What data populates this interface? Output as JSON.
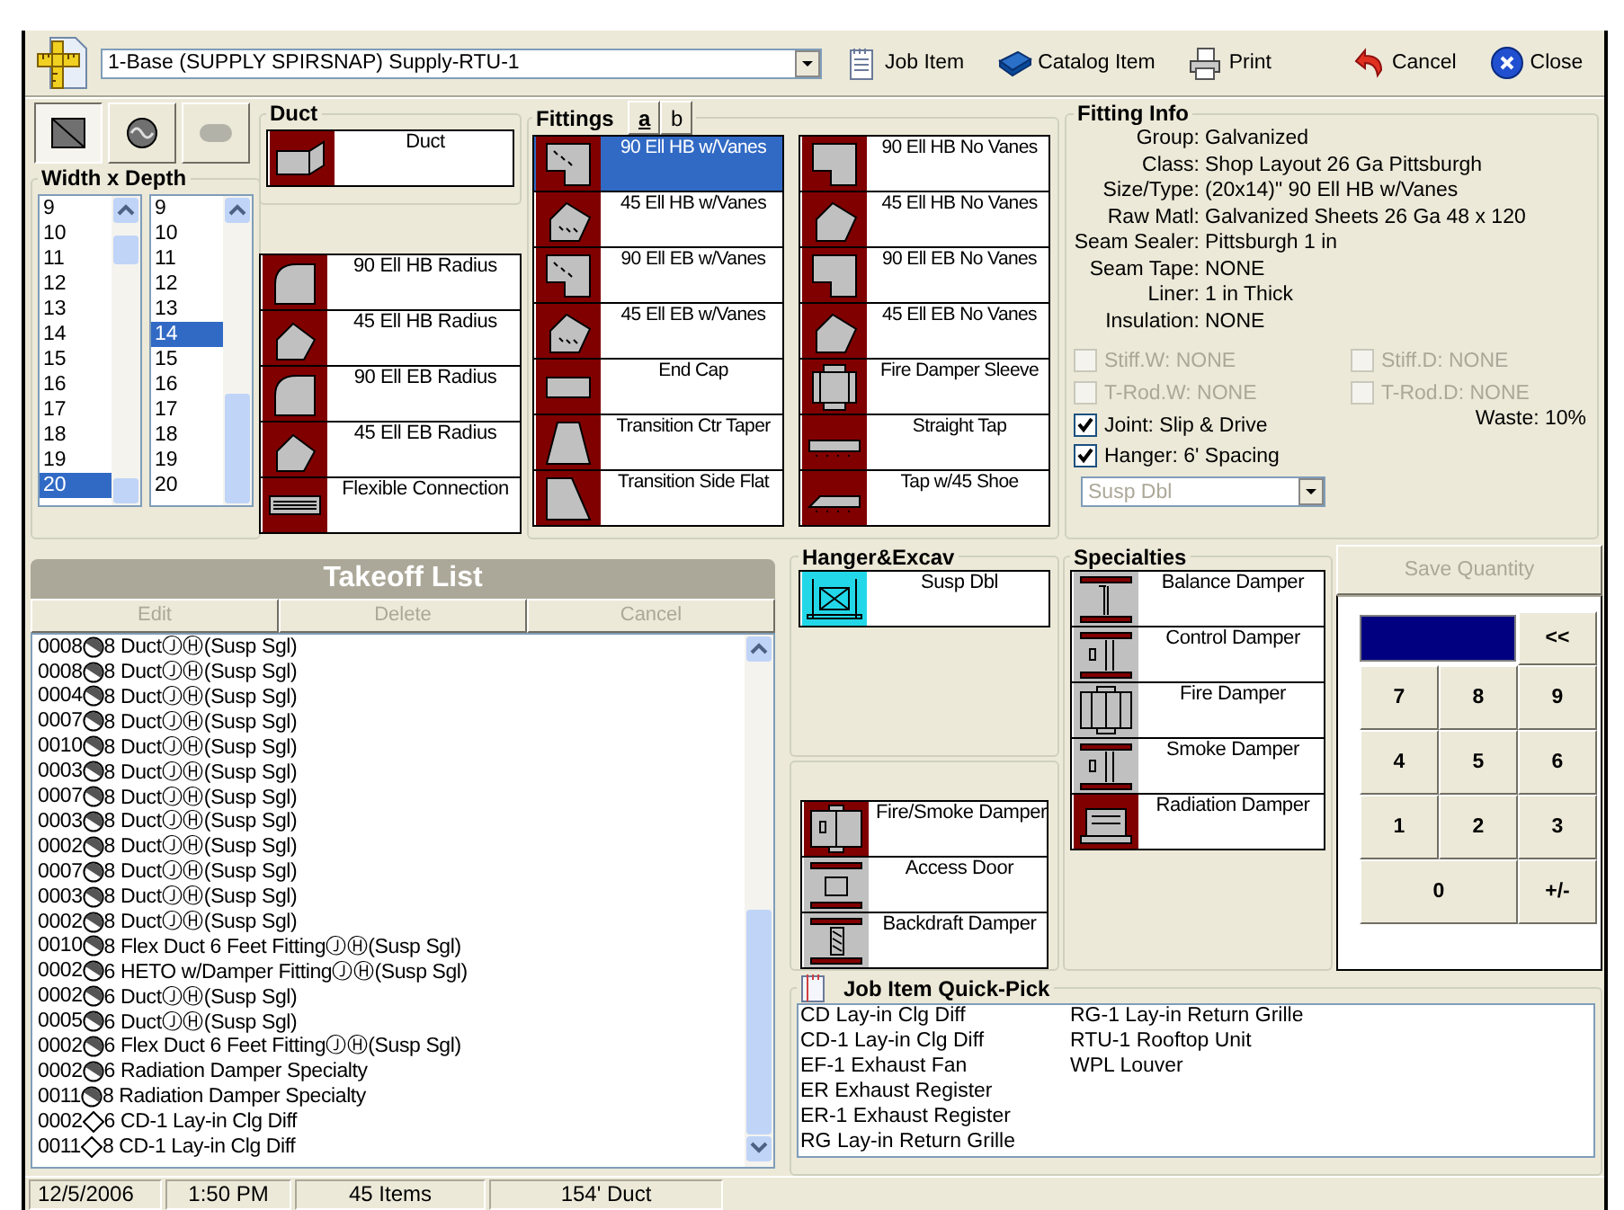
{
  "toolbar": {
    "combo": {
      "value": "1-Base (SUPPLY SPIRSNAP) Supply-RTU-1"
    },
    "buttons": [
      {
        "label": "Job Item",
        "kind": "notepad"
      },
      {
        "label": "Catalog Item",
        "kind": "book"
      },
      {
        "label": "Print",
        "kind": "printer"
      },
      {
        "label": "Cancel",
        "kind": "undo"
      },
      {
        "label": "Close",
        "kind": "close"
      }
    ]
  },
  "shape_buttons": [
    {
      "kind": "rect",
      "selected": true,
      "disabled": false
    },
    {
      "kind": "round",
      "selected": false,
      "disabled": false
    },
    {
      "kind": "oval",
      "selected": false,
      "disabled": true
    }
  ],
  "size_group": {
    "title": "Width x Depth",
    "width": [
      {
        "label": "9",
        "selected": false
      },
      {
        "label": "10",
        "selected": false
      },
      {
        "label": "11",
        "selected": false
      },
      {
        "label": "12",
        "selected": false
      },
      {
        "label": "13",
        "selected": false
      },
      {
        "label": "14",
        "selected": false
      },
      {
        "label": "15",
        "selected": false
      },
      {
        "label": "16",
        "selected": false
      },
      {
        "label": "17",
        "selected": false
      },
      {
        "label": "18",
        "selected": false
      },
      {
        "label": "19",
        "selected": false
      },
      {
        "label": "20",
        "selected": true
      }
    ],
    "depth": [
      {
        "label": "9",
        "selected": false
      },
      {
        "label": "10",
        "selected": false
      },
      {
        "label": "11",
        "selected": false
      },
      {
        "label": "12",
        "selected": false
      },
      {
        "label": "13",
        "selected": false
      },
      {
        "label": "14",
        "selected": true
      },
      {
        "label": "15",
        "selected": false
      },
      {
        "label": "16",
        "selected": false
      },
      {
        "label": "17",
        "selected": false
      },
      {
        "label": "18",
        "selected": false
      },
      {
        "label": "19",
        "selected": false
      },
      {
        "label": "20",
        "selected": false
      }
    ]
  },
  "duct": {
    "title": "Duct",
    "items": [
      {
        "label": "Duct",
        "kind": "duct"
      }
    ]
  },
  "duct_fittings": [
    {
      "label": "90 Ell HB Radius",
      "kind": "ell90"
    },
    {
      "label": "45 Ell HB Radius",
      "kind": "ell45"
    },
    {
      "label": "90 Ell EB Radius",
      "kind": "ell90"
    },
    {
      "label": "45 Ell EB Radius",
      "kind": "ell45"
    },
    {
      "label": "Flexible Connection",
      "kind": "flex"
    }
  ],
  "fittings": {
    "title": "Fittings",
    "tabs": [
      {
        "label": "a",
        "selected": true
      },
      {
        "label": "b",
        "selected": false
      }
    ],
    "items": [
      {
        "label": "90 Ell HB w/Vanes",
        "kind": "vanes90",
        "selected": true
      },
      {
        "label": "45 Ell HB w/Vanes",
        "kind": "vanes45",
        "selected": false
      },
      {
        "label": "90 Ell EB w/Vanes",
        "kind": "vanes90",
        "selected": false
      },
      {
        "label": "45 Ell EB w/Vanes",
        "kind": "vanes45",
        "selected": false
      },
      {
        "label": "End Cap",
        "kind": "endcap",
        "selected": false
      },
      {
        "label": "Transition Ctr Taper",
        "kind": "taper",
        "selected": false
      },
      {
        "label": "Transition Side Flat",
        "kind": "sideflat",
        "selected": false
      },
      {
        "label": "90 Ell HB No Vanes",
        "kind": "square90",
        "selected": false
      },
      {
        "label": "45 Ell HB No Vanes",
        "kind": "square45",
        "selected": false
      },
      {
        "label": "90 Ell EB No Vanes",
        "kind": "square90",
        "selected": false
      },
      {
        "label": "45 Ell EB No Vanes",
        "kind": "square45",
        "selected": false
      },
      {
        "label": "Fire Damper Sleeve",
        "kind": "sleeve",
        "selected": false
      },
      {
        "label": "Straight Tap",
        "kind": "tap",
        "selected": false
      },
      {
        "label": "Tap w/45 Shoe",
        "kind": "tap45",
        "selected": false
      }
    ]
  },
  "fitting_info": {
    "title": "Fitting Info",
    "rows": [
      {
        "label": "Group:",
        "value": "Galvanized"
      },
      {
        "label": "Class:",
        "value": "Shop Layout 26 Ga Pittsburgh"
      },
      {
        "label": "Size/Type:",
        "value": "(20x14)\" 90 Ell HB w/Vanes"
      },
      {
        "label": "Raw Matl:",
        "value": "Galvanized Sheets 26 Ga 48 x 120"
      },
      {
        "label": "Seam Sealer:",
        "value": "Pittsburgh 1 in"
      },
      {
        "label": "Seam Tape:",
        "value": "NONE"
      },
      {
        "label": "Liner:",
        "value": "1 in Thick"
      },
      {
        "label": "Insulation:",
        "value": "NONE"
      }
    ],
    "stiffeners": [
      {
        "label": "Stiff.W: NONE",
        "checked": false,
        "disabled": true
      },
      {
        "label": "Stiff.D: NONE",
        "checked": false,
        "disabled": true
      },
      {
        "label": "T-Rod.W: NONE",
        "checked": false,
        "disabled": true
      },
      {
        "label": "T-Rod.D: NONE",
        "checked": false,
        "disabled": true
      }
    ],
    "options": [
      {
        "label": "Joint: Slip & Drive",
        "checked": true,
        "disabled": false
      },
      {
        "label": "Hanger: 6' Spacing",
        "checked": true,
        "disabled": false
      }
    ],
    "waste": "Waste: 10%",
    "hanger_combo": {
      "value": "Susp Dbl",
      "disabled": true
    }
  },
  "takeoff": {
    "title": "Takeoff List",
    "buttons": [
      {
        "label": "Edit",
        "disabled": true
      },
      {
        "label": "Delete",
        "disabled": true
      },
      {
        "label": "Cancel",
        "disabled": true
      }
    ],
    "rows": [
      {
        "qty": "0008",
        "kind": "round",
        "text": "8 DuctⒿⒽ(Susp Sgl)"
      },
      {
        "qty": "0008",
        "kind": "round",
        "text": "8 DuctⒿⒽ(Susp Sgl)"
      },
      {
        "qty": "0004",
        "kind": "round",
        "text": "8 DuctⒿⒽ(Susp Sgl)"
      },
      {
        "qty": "0007",
        "kind": "round",
        "text": "8 DuctⒿⒽ(Susp Sgl)"
      },
      {
        "qty": "0010",
        "kind": "round",
        "text": "8 DuctⒿⒽ(Susp Sgl)"
      },
      {
        "qty": "0003",
        "kind": "round",
        "text": "8 DuctⒿⒽ(Susp Sgl)"
      },
      {
        "qty": "0007",
        "kind": "round",
        "text": "8 DuctⒿⒽ(Susp Sgl)"
      },
      {
        "qty": "0003",
        "kind": "round",
        "text": "8 DuctⒿⒽ(Susp Sgl)"
      },
      {
        "qty": "0002",
        "kind": "round",
        "text": "8 DuctⒿⒽ(Susp Sgl)"
      },
      {
        "qty": "0007",
        "kind": "round",
        "text": "8 DuctⒿⒽ(Susp Sgl)"
      },
      {
        "qty": "0003",
        "kind": "round",
        "text": "8 DuctⒿⒽ(Susp Sgl)"
      },
      {
        "qty": "0002",
        "kind": "round",
        "text": "8 DuctⒿⒽ(Susp Sgl)"
      },
      {
        "qty": "0010",
        "kind": "round",
        "text": "8 Flex Duct 6 Feet FittingⒿⒽ(Susp Sgl)"
      },
      {
        "qty": "0002",
        "kind": "round",
        "text": "6 HETO w/Damper FittingⒿⒽ(Susp Sgl)"
      },
      {
        "qty": "0002",
        "kind": "round",
        "text": "6 DuctⒿⒽ(Susp Sgl)"
      },
      {
        "qty": "0005",
        "kind": "round",
        "text": "6 DuctⒿⒽ(Susp Sgl)"
      },
      {
        "qty": "0002",
        "kind": "round",
        "text": "6 Flex Duct 6 Feet FittingⒿⒽ(Susp Sgl)"
      },
      {
        "qty": "0002",
        "kind": "round",
        "text": "6 Radiation Damper Specialty"
      },
      {
        "qty": "0011",
        "kind": "round",
        "text": "8 Radiation Damper Specialty"
      },
      {
        "qty": "0002",
        "kind": "diamond",
        "text": "6 CD-1 Lay-in Clg Diff"
      },
      {
        "qty": "0011",
        "kind": "diamond",
        "text": "8 CD-1 Lay-in Clg Diff"
      }
    ]
  },
  "hanger": {
    "title": "Hanger&Excav",
    "items": [
      {
        "label": "Susp Dbl",
        "kind": "susp"
      }
    ]
  },
  "accessories": [
    {
      "label": "Fire/Smoke Damper",
      "kind": "firesmoke"
    },
    {
      "label": "Access Door",
      "kind": "door"
    },
    {
      "label": "Backdraft Damper",
      "kind": "backdraft"
    }
  ],
  "specialties": {
    "title": "Specialties",
    "items": [
      {
        "label": "Balance Damper",
        "kind": "balance"
      },
      {
        "label": "Control Damper",
        "kind": "control"
      },
      {
        "label": "Fire Damper",
        "kind": "fire"
      },
      {
        "label": "Smoke Damper",
        "kind": "control"
      },
      {
        "label": "Radiation Damper",
        "kind": "radiation"
      }
    ]
  },
  "keypad": {
    "save_button": {
      "label": "Save Quantity",
      "disabled": true
    },
    "keys": [
      {
        "label": "<<",
        "kind": "normal"
      },
      {
        "label": "7",
        "kind": "normal"
      },
      {
        "label": "8",
        "kind": "normal"
      },
      {
        "label": "9",
        "kind": "normal"
      },
      {
        "label": "4",
        "kind": "normal"
      },
      {
        "label": "5",
        "kind": "normal"
      },
      {
        "label": "6",
        "kind": "normal"
      },
      {
        "label": "1",
        "kind": "normal"
      },
      {
        "label": "2",
        "kind": "normal"
      },
      {
        "label": "3",
        "kind": "normal"
      },
      {
        "label": "0",
        "kind": "wide"
      },
      {
        "label": "+/-",
        "kind": "normal"
      }
    ]
  },
  "quick_pick": {
    "title": "Job Item Quick-Pick",
    "items": [
      "CD Lay-in Clg Diff",
      "CD-1 Lay-in Clg Diff",
      "EF-1 Exhaust Fan",
      "ER Exhaust Register",
      "ER-1 Exhaust Register",
      "RG Lay-in Return Grille",
      "RG-1 Lay-in Return Grille",
      "RTU-1 Rooftop Unit",
      "WPL Louver"
    ]
  },
  "status_bar": [
    "12/5/2006",
    "1:50 PM",
    "45 Items",
    "154' Duct"
  ]
}
